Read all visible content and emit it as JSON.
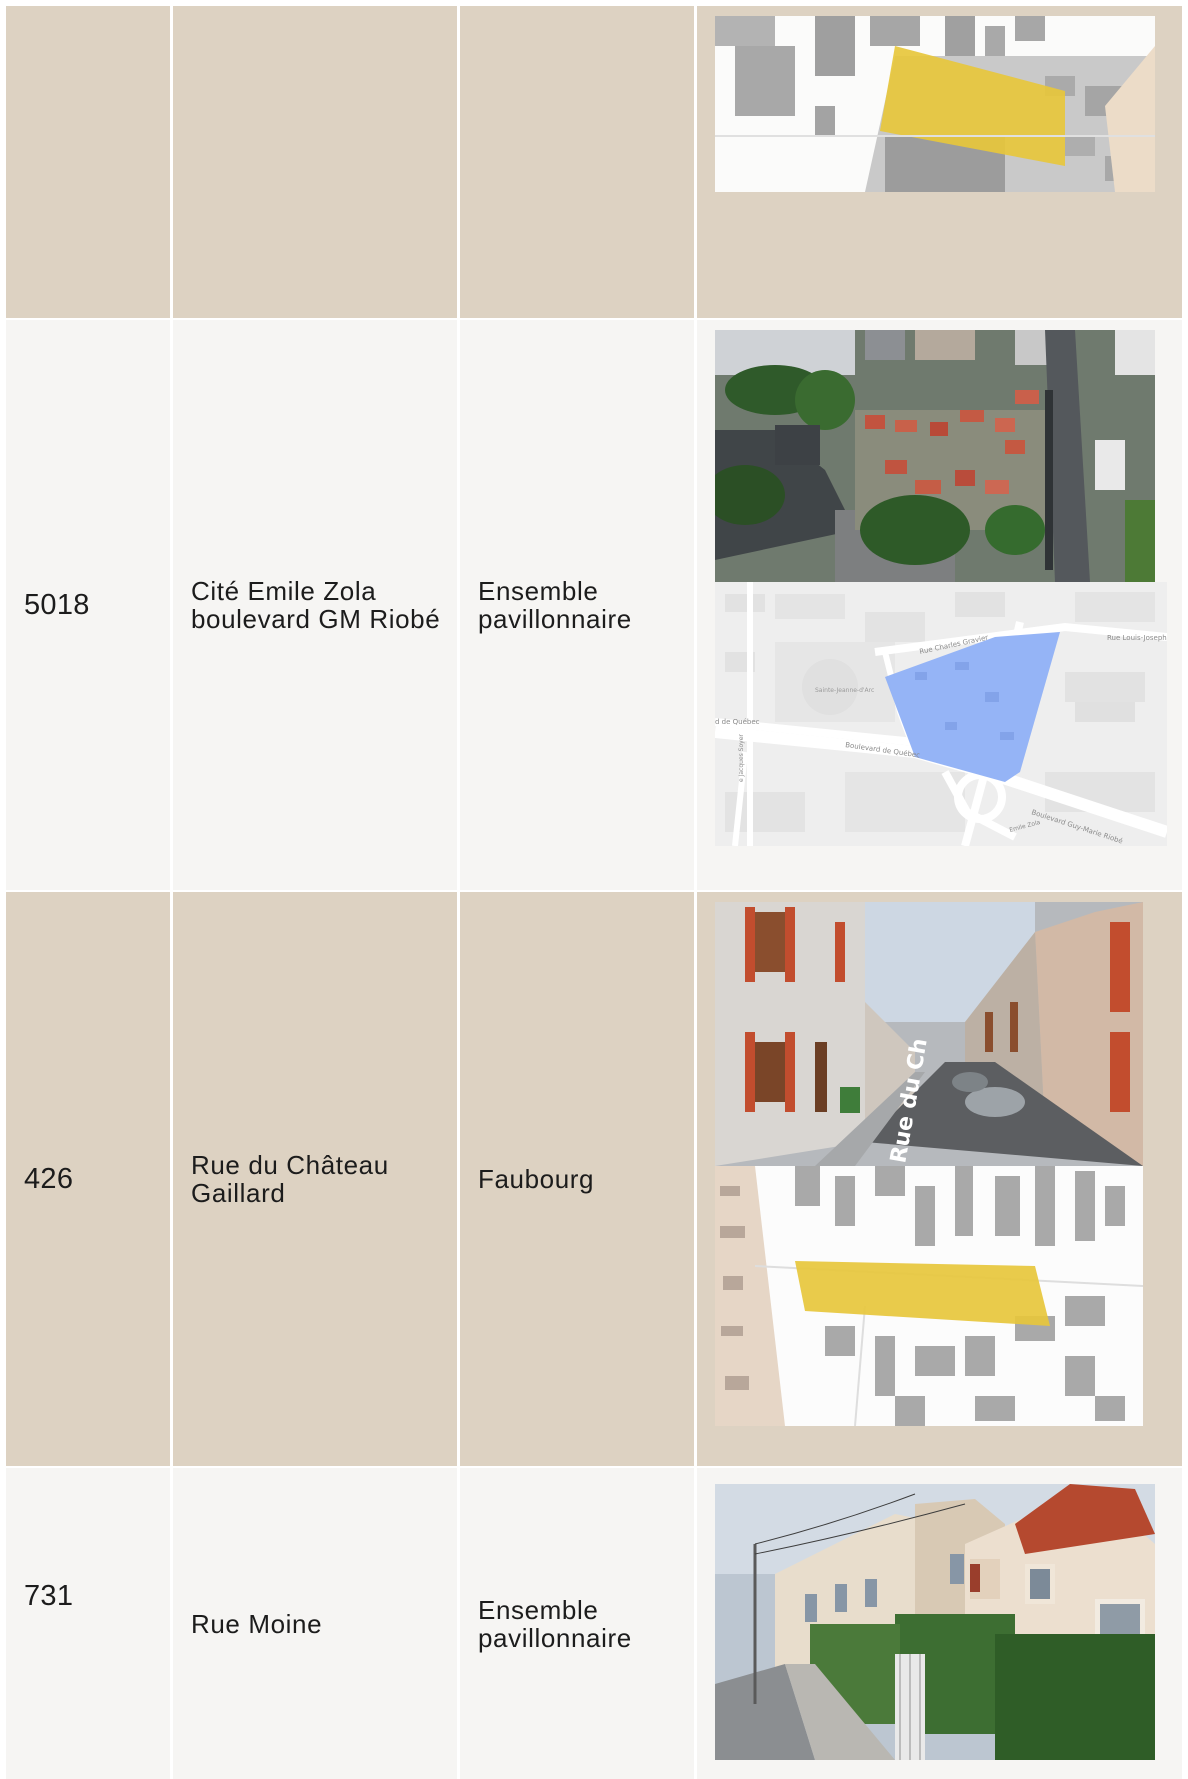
{
  "rows": [
    {
      "id": "",
      "address": "",
      "type": "",
      "images": [
        "plan-cadastral"
      ]
    },
    {
      "id": "5018",
      "address": "Cité Emile Zola boulevard GM Riobé",
      "type": "Ensemble pavillonnaire",
      "images": [
        "vue-aerienne",
        "plan-carte"
      ]
    },
    {
      "id": "426",
      "address": "Rue du Château Gaillard",
      "type": "Faubourg",
      "images": [
        "vue-de-rue",
        "plan-cadastral"
      ]
    },
    {
      "id": "731",
      "address": "Rue Moine",
      "type": "Ensemble pavillonnaire",
      "images": [
        "vue-de-rue"
      ]
    }
  ],
  "map_labels": {
    "rue_charles_gravier": "Rue Charles Gravier",
    "rue_louis_joseph": "Rue Louis-Joseph F",
    "sainte_jeanne": "Sainte-Jeanne-d'Arc",
    "quebec_left": "d de Québec",
    "boulevard_quebec": "Boulevard de Québec",
    "boulevard_riobe": "Boulevard Guy-Marie Riobé",
    "emile_zola": "Emile Zola",
    "jacques_soyer": "e Jacques Soyer"
  },
  "street_sign": "Rue du Ch",
  "colors": {
    "beige": "#ddd2c2",
    "light": "#f6f5f3",
    "highlight_yellow": "#e8c93a",
    "highlight_blue": "#8fb0f5",
    "building_grey": "#a9a9a9"
  }
}
